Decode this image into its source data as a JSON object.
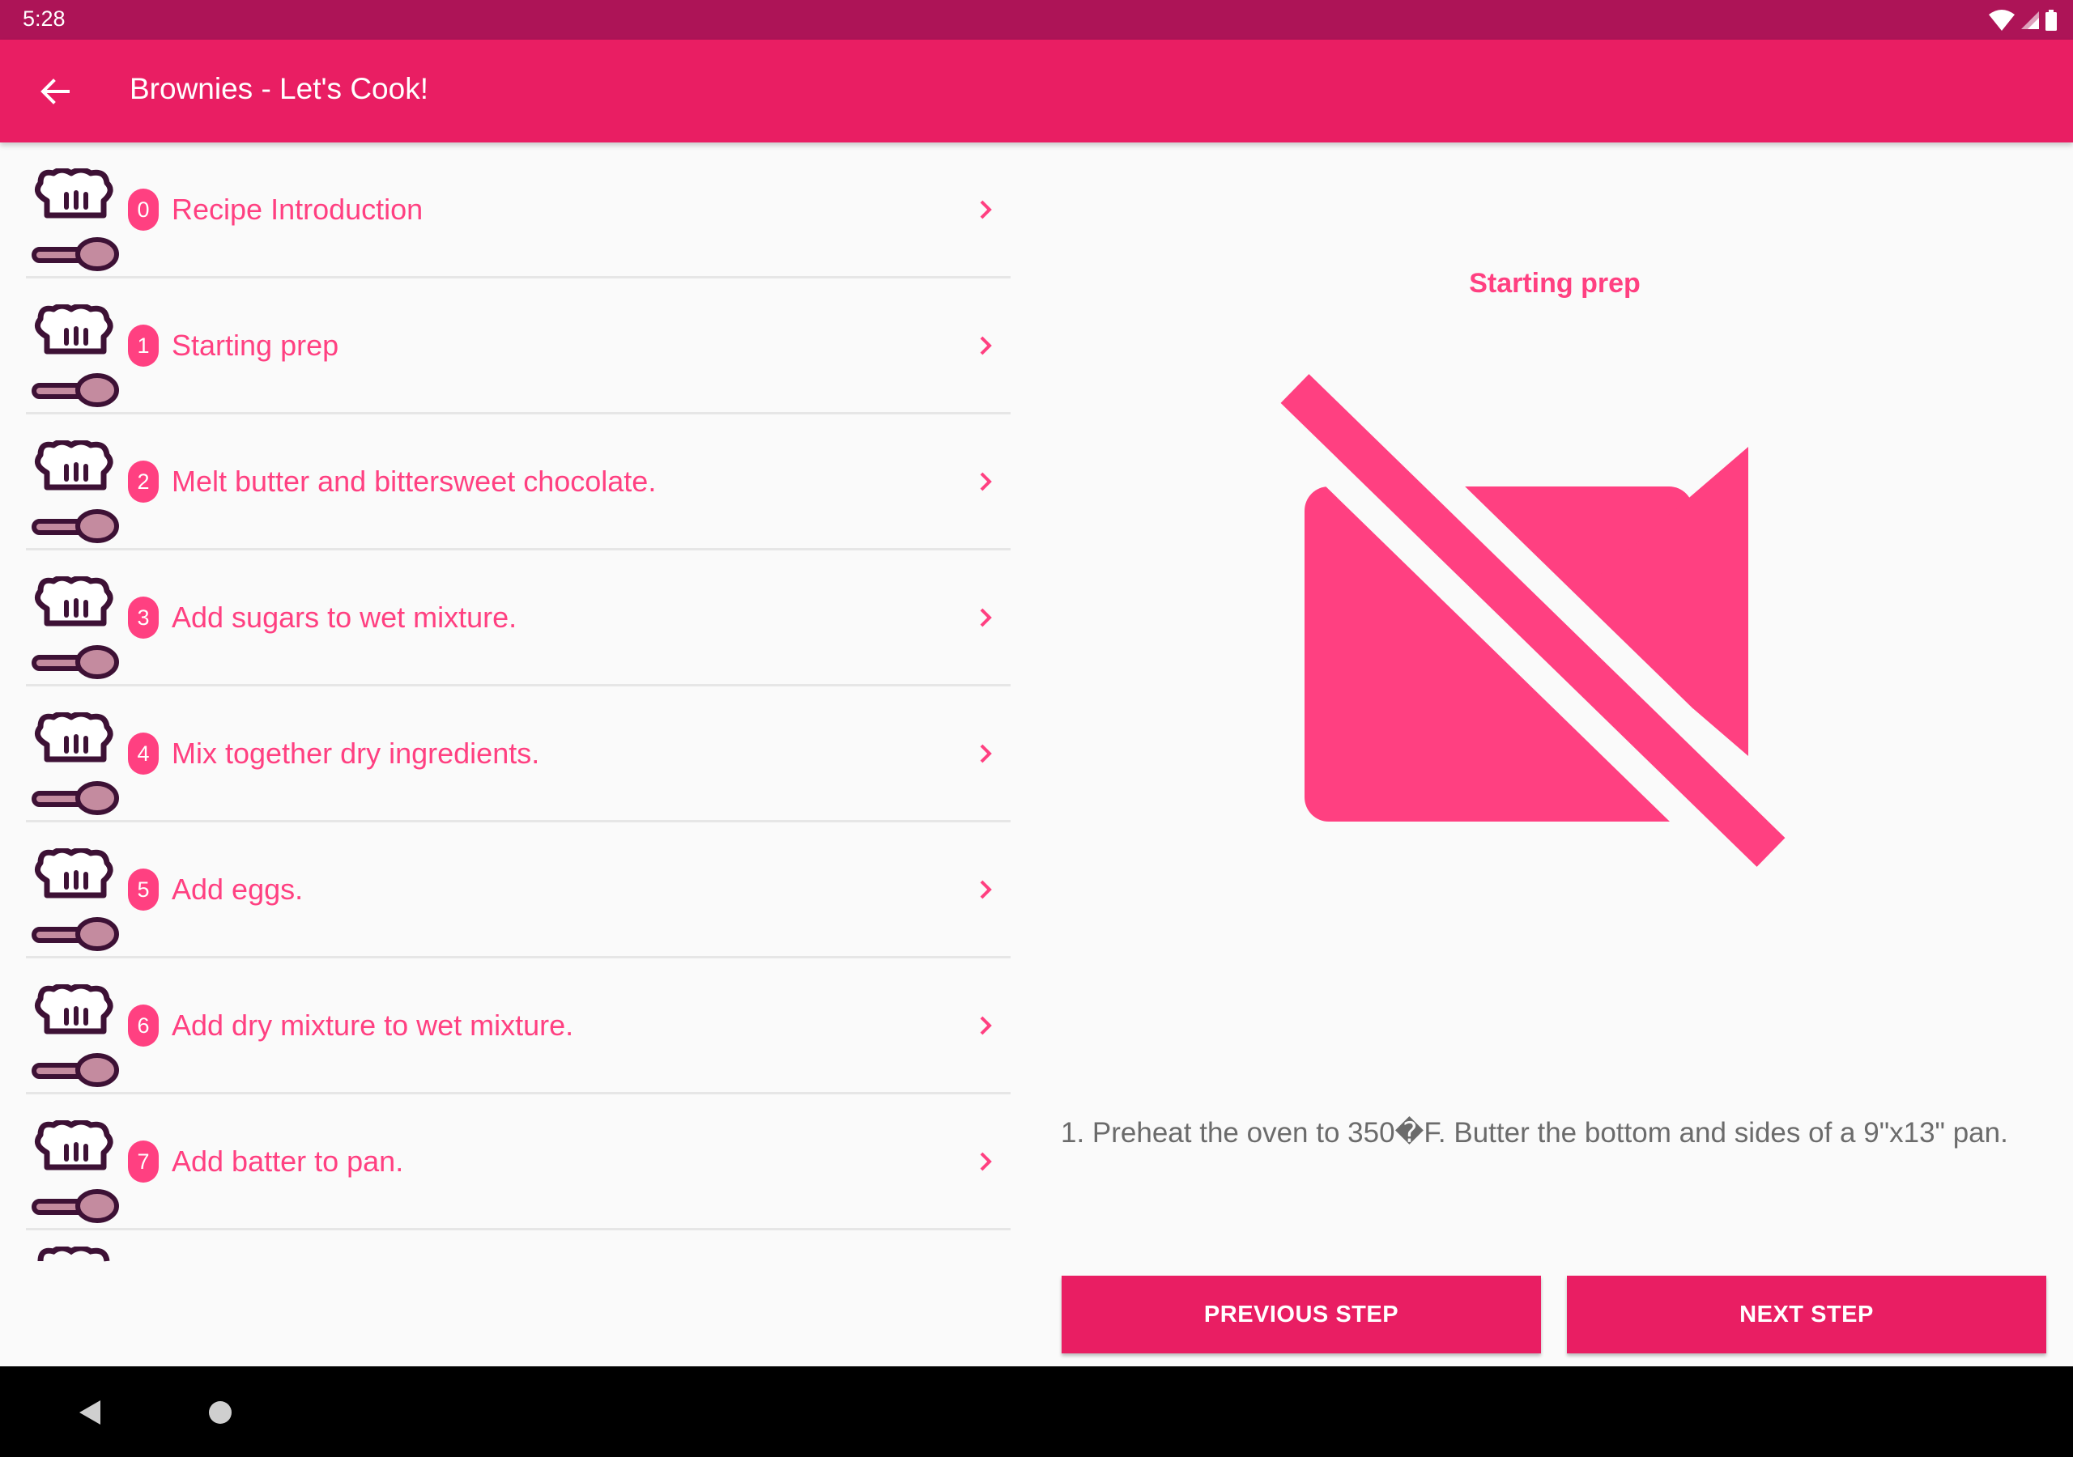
{
  "status": {
    "time": "5:28"
  },
  "app_bar": {
    "title": "Brownies - Let's Cook!"
  },
  "steps": [
    {
      "number": "0",
      "label": "Recipe Introduction"
    },
    {
      "number": "1",
      "label": "Starting prep"
    },
    {
      "number": "2",
      "label": "Melt butter and bittersweet chocolate."
    },
    {
      "number": "3",
      "label": "Add sugars to wet mixture."
    },
    {
      "number": "4",
      "label": "Mix together dry ingredients."
    },
    {
      "number": "5",
      "label": "Add eggs."
    },
    {
      "number": "6",
      "label": "Add dry mixture to wet mixture."
    },
    {
      "number": "7",
      "label": "Add batter to pan."
    }
  ],
  "detail": {
    "title": "Starting prep",
    "description": "1. Preheat the oven to 350�F. Butter the bottom and sides of a 9\"x13\" pan.",
    "previous_label": "PREVIOUS STEP",
    "next_label": "NEXT STEP"
  },
  "icons": {
    "back": "arrow-back-icon",
    "chef": "chef-hat-spoon-icon",
    "chevron": "chevron-right-icon",
    "video_off": "videocam-off-icon"
  },
  "colors": {
    "primary": "#e91e63",
    "primary_dark": "#ad1457",
    "accent": "#ff4081",
    "chef_stroke": "#3d1135",
    "spoon_fill": "#c48b9f"
  }
}
